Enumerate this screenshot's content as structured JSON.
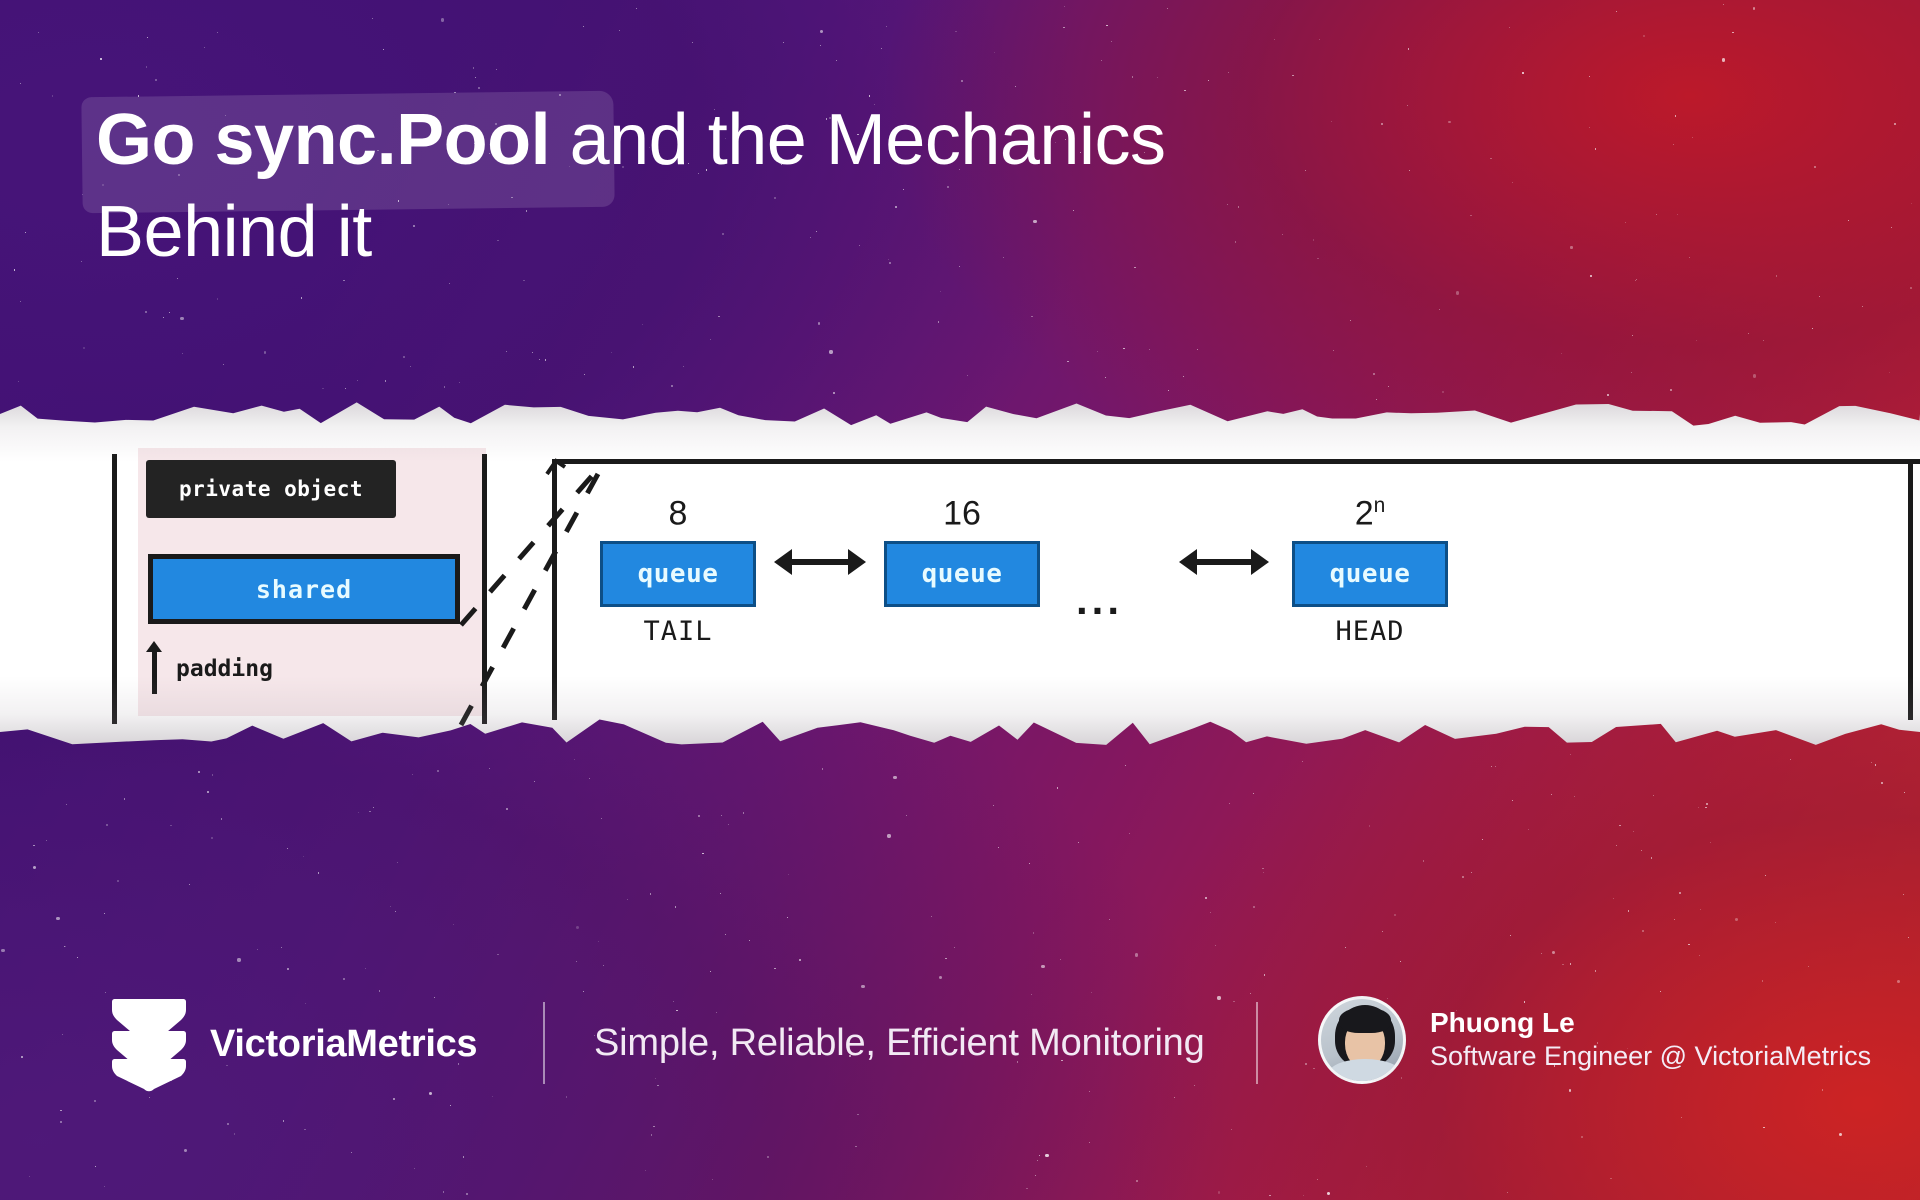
{
  "slide": {
    "title_line1_highlight": "Go sync.Pool",
    "title_line1_rest": " and the Mechanics",
    "title_line2": "Behind it"
  },
  "diagram": {
    "left_pane": {
      "private_box_label": "private object",
      "shared_box_label": "shared",
      "padding_label": "padding"
    },
    "chain": {
      "items": [
        {
          "size": "8",
          "size_sup": "",
          "box_label": "queue",
          "end_label": "TAIL"
        },
        {
          "size": "16",
          "size_sup": "",
          "box_label": "queue",
          "end_label": ""
        },
        {
          "size": "2",
          "size_sup": "n",
          "box_label": "queue",
          "end_label": "HEAD"
        }
      ],
      "ellipsis": "..."
    }
  },
  "footer": {
    "brand": "VictoriaMetrics",
    "tagline": "Simple, Reliable, Efficient Monitoring",
    "author_name": "Phuong Le",
    "author_role": "Software Engineer @ VictoriaMetrics"
  },
  "colors": {
    "accent_blue": "#2288e0",
    "ink": "#1a1a1a",
    "paper": "#ffffff",
    "pane_pink": "#f6e7ea",
    "brand_purple": "#4b1484",
    "brand_red": "#c42a2e"
  }
}
